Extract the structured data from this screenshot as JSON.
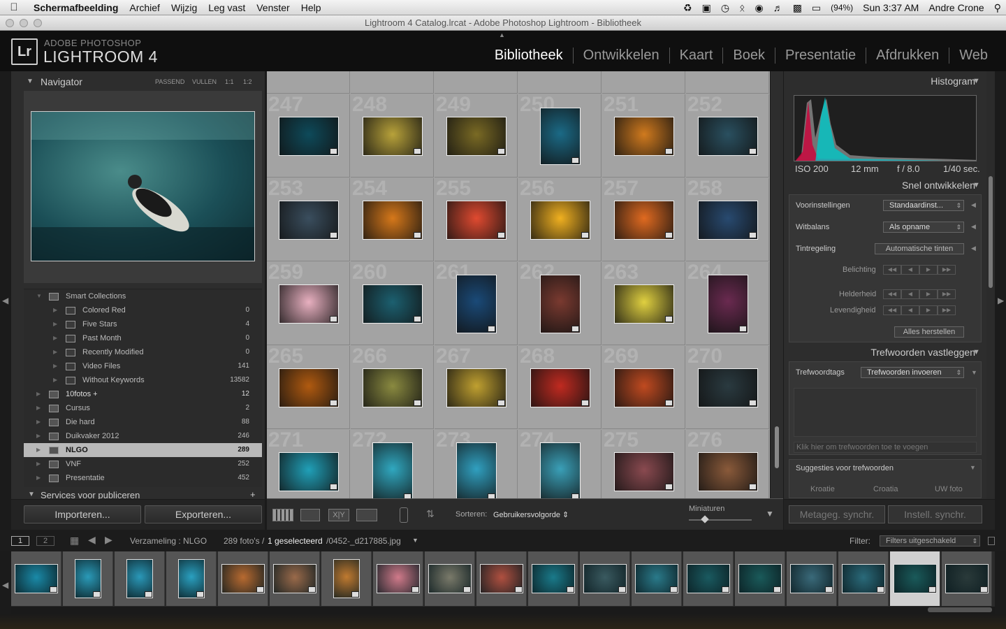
{
  "menubar": {
    "items": [
      "Schermafbeelding",
      "Archief",
      "Wijzig",
      "Leg vast",
      "Venster",
      "Help"
    ],
    "battery": "(94%)",
    "clock": "Sun 3:37 AM",
    "user": "Andre Crone"
  },
  "window": {
    "title": "Lightroom 4 Catalog.lrcat - Adobe Photoshop Lightroom - Bibliotheek"
  },
  "identity": {
    "logo": "Lr",
    "line1": "ADOBE PHOTOSHOP",
    "line2": "LIGHTROOM 4"
  },
  "modules": [
    "Bibliotheek",
    "Ontwikkelen",
    "Kaart",
    "Boek",
    "Presentatie",
    "Afdrukken",
    "Web"
  ],
  "active_module": "Bibliotheek",
  "navigator": {
    "title": "Navigator",
    "zoom_options": [
      "PASSEND",
      "VULLEN",
      "1:1",
      "1:2"
    ]
  },
  "collections": [
    {
      "label": "Smart Collections",
      "count": "",
      "level": 0,
      "expanded": true
    },
    {
      "label": "Colored Red",
      "count": "0",
      "level": 1
    },
    {
      "label": "Five Stars",
      "count": "4",
      "level": 1
    },
    {
      "label": "Past Month",
      "count": "0",
      "level": 1
    },
    {
      "label": "Recently Modified",
      "count": "0",
      "level": 1
    },
    {
      "label": "Video Files",
      "count": "141",
      "level": 1
    },
    {
      "label": "Without Keywords",
      "count": "13582",
      "level": 1
    },
    {
      "label": "10fotos  +",
      "count": "12",
      "level": 0,
      "bold": true
    },
    {
      "label": "Cursus",
      "count": "2",
      "level": 0
    },
    {
      "label": "Die hard",
      "count": "88",
      "level": 0
    },
    {
      "label": "Duikvaker 2012",
      "count": "246",
      "level": 0
    },
    {
      "label": "NLGO",
      "count": "289",
      "level": 0,
      "selected": true
    },
    {
      "label": "VNF",
      "count": "252",
      "level": 0
    },
    {
      "label": "Presentatie",
      "count": "452",
      "level": 0
    }
  ],
  "services_header": "Services voor publiceren",
  "buttons": {
    "import": "Importeren...",
    "export": "Exporteren..."
  },
  "grid": {
    "rows": [
      {
        "numbers": [
          "247",
          "248",
          "249",
          "250",
          "251",
          "252"
        ]
      },
      {
        "numbers": [
          "253",
          "254",
          "255",
          "256",
          "257",
          "258"
        ]
      },
      {
        "numbers": [
          "259",
          "260",
          "261",
          "262",
          "263",
          "264"
        ]
      },
      {
        "numbers": [
          "265",
          "266",
          "267",
          "268",
          "269",
          "270"
        ]
      },
      {
        "numbers": [
          "271",
          "272",
          "273",
          "274",
          "275",
          "276"
        ]
      }
    ]
  },
  "toolbar": {
    "sort_label": "Sorteren:",
    "sort_value": "Gebruikersvolgorde",
    "thumbs_label": "Miniaturen",
    "thumbs_size": 0.26
  },
  "histogram": {
    "title": "Histogram",
    "iso": "ISO 200",
    "focal": "12 mm",
    "aperture": "f / 8.0",
    "shutter": "1/40 sec."
  },
  "quick_develop": {
    "title": "Snel ontwikkelen",
    "preset_label": "Voorinstellingen",
    "preset_value": "Standaardinst...",
    "wb_label": "Witbalans",
    "wb_value": "Als opname",
    "tone_label": "Tintregeling",
    "auto_tone": "Automatische tinten",
    "exposure": "Belichting",
    "clarity": "Helderheid",
    "vibrance": "Levendigheid",
    "reset": "Alles herstellen"
  },
  "keywording": {
    "title": "Trefwoorden vastleggen",
    "tags_label": "Trefwoordtags",
    "tags_value": "Trefwoorden invoeren",
    "placeholder": "Klik hier om trefwoorden toe te voegen",
    "suggest_label": "Suggesties voor trefwoorden",
    "suggestions": [
      "Kroatie",
      "Croatia",
      "UW foto"
    ]
  },
  "sync": {
    "metadata": "Metageg. synchr.",
    "settings": "Instell. synchr."
  },
  "filmstrip": {
    "page1": "1",
    "page2": "2",
    "source": "Verzameling : NLGO",
    "count": "289 foto's /",
    "selected": "1 geselecteerd",
    "file": "/0452-_d217885.jpg",
    "filter_label": "Filter:",
    "filter_value": "Filters uitgeschakeld"
  },
  "colors": {
    "accent": "#ffffff",
    "grid_bg": "#a3a3a3",
    "panel_bg": "#2d2d2d"
  }
}
